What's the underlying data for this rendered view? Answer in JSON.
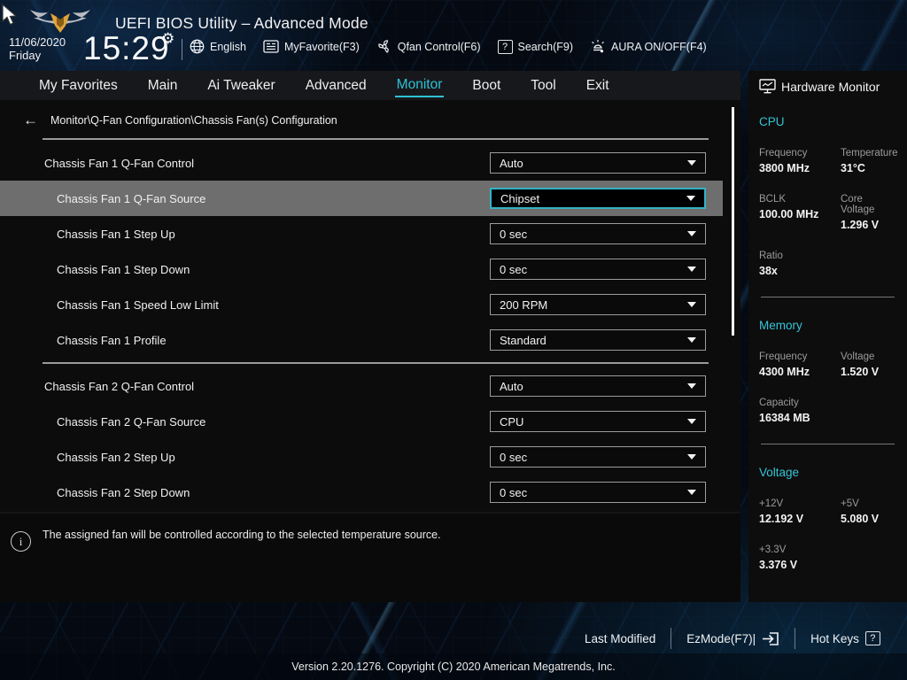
{
  "header": {
    "title": "UEFI BIOS Utility – Advanced Mode",
    "date": "11/06/2020",
    "day": "Friday",
    "time": "15:29",
    "toolbar": [
      {
        "icon": "globe-icon",
        "label": "English"
      },
      {
        "icon": "myfavorite-icon",
        "label": "MyFavorite(F3)"
      },
      {
        "icon": "qfan-icon",
        "label": "Qfan Control(F6)"
      },
      {
        "icon": "search-icon",
        "label": "Search(F9)",
        "badge": "?"
      },
      {
        "icon": "aura-icon",
        "label": "AURA ON/OFF(F4)"
      }
    ]
  },
  "tabs": [
    "My Favorites",
    "Main",
    "Ai Tweaker",
    "Advanced",
    "Monitor",
    "Boot",
    "Tool",
    "Exit"
  ],
  "active_tab": "Monitor",
  "main": {
    "breadcrumb": "Monitor\\Q-Fan Configuration\\Chassis Fan(s) Configuration",
    "back_arrow": "←",
    "rows": [
      {
        "label": "Chassis Fan 1 Q-Fan Control",
        "value": "Auto"
      },
      {
        "label": "Chassis Fan 1 Q-Fan Source",
        "value": "Chipset"
      },
      {
        "label": "Chassis Fan 1 Step Up",
        "value": "0 sec"
      },
      {
        "label": "Chassis Fan 1 Step Down",
        "value": "0 sec"
      },
      {
        "label": "Chassis Fan 1 Speed Low Limit",
        "value": "200 RPM"
      },
      {
        "label": "Chassis Fan 1 Profile",
        "value": "Standard"
      },
      {
        "label": "Chassis Fan 2 Q-Fan Control",
        "value": "Auto"
      },
      {
        "label": "Chassis Fan 2 Q-Fan Source",
        "value": "CPU"
      },
      {
        "label": "Chassis Fan 2 Step Up",
        "value": "0 sec"
      },
      {
        "label": "Chassis Fan 2 Step Down",
        "value": "0 sec"
      }
    ],
    "selected_row_index": 1
  },
  "info": {
    "symbol": "i",
    "text": "The assigned fan will be controlled according to the selected temperature source."
  },
  "sidebar": {
    "title": "Hardware Monitor",
    "cpu": {
      "heading": "CPU",
      "freq_label": "Frequency",
      "freq": "3800 MHz",
      "temp_label": "Temperature",
      "temp": "31°C",
      "bclk_label": "BCLK",
      "bclk": "100.00 MHz",
      "corev_label": "Core Voltage",
      "corev": "1.296 V",
      "ratio_label": "Ratio",
      "ratio": "38x"
    },
    "memory": {
      "heading": "Memory",
      "freq_label": "Frequency",
      "freq": "4300 MHz",
      "volt_label": "Voltage",
      "volt": "1.520 V",
      "cap_label": "Capacity",
      "cap": "16384 MB"
    },
    "voltage": {
      "heading": "Voltage",
      "v12_label": "+12V",
      "v12": "12.192 V",
      "v5_label": "+5V",
      "v5": "5.080 V",
      "v33_label": "+3.3V",
      "v33": "3.376 V"
    }
  },
  "footer": {
    "last_modified": "Last Modified",
    "ezmode": "EzMode(F7)|",
    "hotkeys": "Hot Keys",
    "hotkeys_badge": "?",
    "version": "Version 2.20.1276. Copyright (C) 2020 American Megatrends, Inc."
  },
  "colors": {
    "accent_cyan": "#2fc1d6",
    "selected_row_bg": "#6e6e6e",
    "selected_dropdown_border": "#33b3c4",
    "panel_bg": "#0c0c0c",
    "gold_logo": "#e0a33a"
  },
  "misc": {
    "time_gear": "⚙"
  }
}
